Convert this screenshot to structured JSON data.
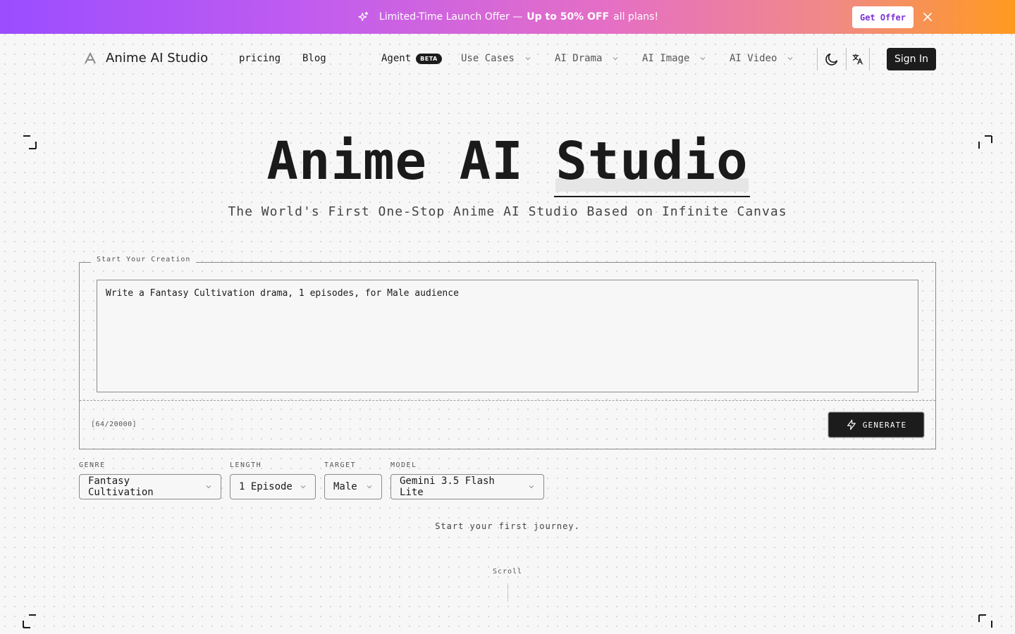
{
  "promo": {
    "text_before": "Limited-Time Launch Offer —",
    "text_bold": "Up to 50% OFF",
    "text_after": "all plans!",
    "button_label": "Get Offer",
    "icon": "sparkle-icon",
    "close_icon": "close-icon"
  },
  "header": {
    "logo_text": "Anime AI Studio",
    "nav": {
      "pricing": "pricing",
      "blog": "Blog",
      "agent": "Agent",
      "agent_badge": "BETA",
      "use_cases": "Use Cases",
      "ai_drama": "AI Drama",
      "ai_image": "AI Image",
      "ai_video": "AI Video"
    },
    "theme_icon": "moon-icon",
    "language_icon": "translate-icon",
    "sign_in": "Sign In"
  },
  "hero": {
    "title_plain": "Anime AI",
    "title_accent": "Studio",
    "subtitle": "The World's First One-Stop Anime AI Studio Based on Infinite Canvas"
  },
  "creation": {
    "legend": "Start Your Creation",
    "prompt_value": "Write a Fantasy Cultivation drama, 1 episodes, for Male audience",
    "char_count": "[64/20000]",
    "generate_label": "GENERATE",
    "generate_icon": "lightning-icon"
  },
  "options": {
    "genre": {
      "label": "GENRE",
      "value": "Fantasy Cultivation"
    },
    "length": {
      "label": "LENGTH",
      "value": "1 Episode"
    },
    "target": {
      "label": "TARGET",
      "value": "Male"
    },
    "model": {
      "label": "MODEL",
      "value": "Gemini 3.5 Flash Lite"
    }
  },
  "journey_text": "Start your first journey.",
  "scroll_label": "Scroll",
  "colors": {
    "banner_start": "#9b4dff",
    "banner_end": "#ff9a1f",
    "dark": "#1c1c1c",
    "offer_text": "#7a2fd6"
  }
}
